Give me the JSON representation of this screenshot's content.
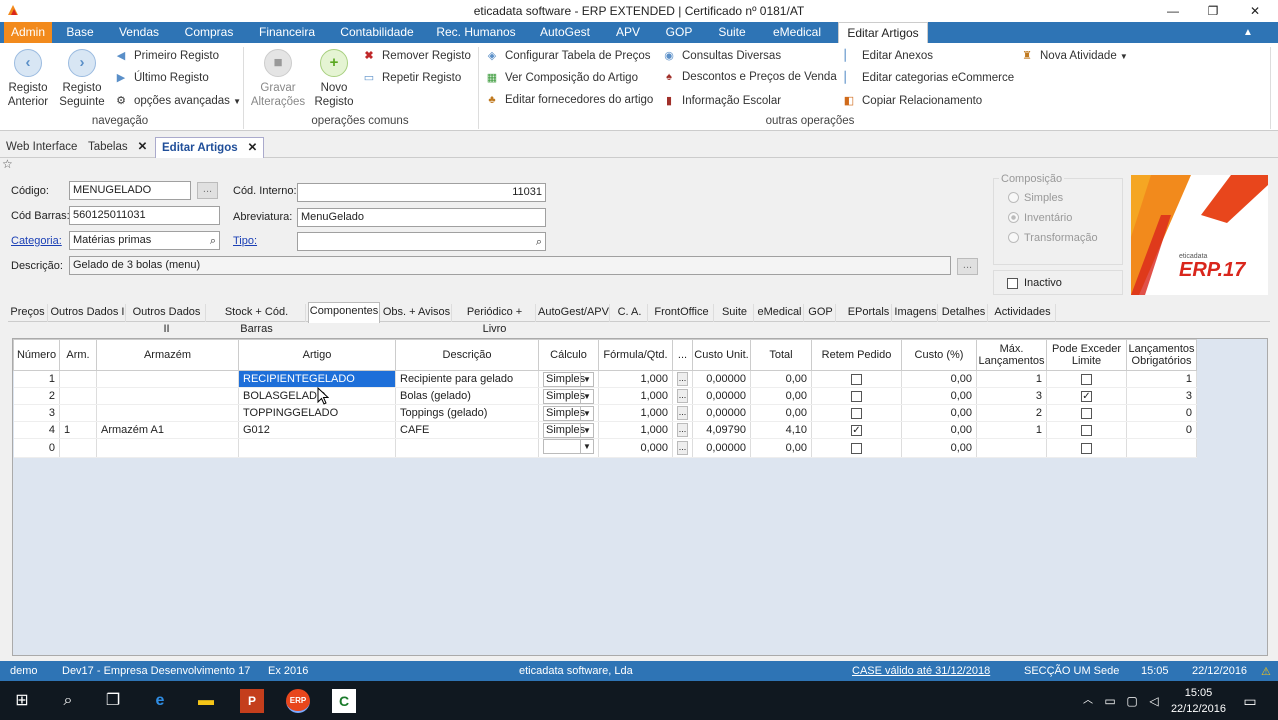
{
  "window": {
    "title": "eticadata software - ERP EXTENDED | Certificado nº 0181/AT",
    "minimize": "—",
    "restore": "❐",
    "close": "✕"
  },
  "menu": [
    "Admin",
    "Base",
    "Vendas",
    "Compras",
    "Financeira",
    "Contabilidade",
    "Rec. Humanos",
    "AutoGest",
    "APV",
    "GOP",
    "Suite",
    "eMedical",
    "Editar Artigos"
  ],
  "ribbon": {
    "nav": {
      "prev": "Registo Anterior",
      "next": "Registo Seguinte",
      "first": "Primeiro Registo",
      "last": "Último Registo",
      "advanced": "opções avançadas",
      "group": "navegação"
    },
    "common": {
      "save": "Gravar Alterações",
      "new": "Novo Registo",
      "remove": "Remover Registo",
      "repeat": "Repetir Registo",
      "group": "operações comuns"
    },
    "other": {
      "cfg_prices": "Configurar Tabela de Preços",
      "composition": "Ver Composição do Artigo",
      "suppliers": "Editar fornecedores do artigo",
      "queries": "Consultas Diversas",
      "discounts": "Descontos e Preços de Venda",
      "school": "Informação Escolar",
      "attachments": "Editar Anexos",
      "ecommerce": "Editar categorias eCommerce",
      "copy_rel": "Copiar Relacionamento",
      "new_activity": "Nova Atividade",
      "group": "outras operações"
    }
  },
  "doctabs": [
    "Web Interface",
    "Tabelas",
    "Editar Artigos"
  ],
  "form": {
    "codigo_label": "Código:",
    "codigo": "MENUGELADO",
    "barras_label": "Cód Barras:",
    "barras": "560125011031",
    "categoria_label": "Categoria:",
    "categoria": "Matérias primas",
    "descricao_label": "Descrição:",
    "descricao": "Gelado de 3 bolas (menu)",
    "interno_label": "Cód. Interno:",
    "interno": "11031",
    "abrev_label": "Abreviatura:",
    "abrev": "MenuGelado",
    "tipo_label": "Tipo:",
    "tipo": "",
    "composicao_label": "Composição",
    "opt_simples": "Simples",
    "opt_inventario": "Inventário",
    "opt_transformacao": "Transformação",
    "inactivo": "Inactivo"
  },
  "logo": {
    "brand": "eticadata",
    "product": "ERP.17"
  },
  "subtabs": [
    "Preços",
    "Outros Dados I",
    "Outros Dados II",
    "Stock + Cód. Barras",
    "Componentes",
    "Obs. + Avisos",
    "Periódico + Livro",
    "AutoGest/APV",
    "C. A.",
    "FrontOffice",
    "Suite",
    "eMedical",
    "GOP",
    "EPortals",
    "Imagens",
    "Detalhes",
    "Actividades"
  ],
  "grid": {
    "headers": [
      "Número",
      "Arm.",
      "Armazém",
      "Artigo",
      "Descrição",
      "Cálculo",
      "Fórmula/Qtd.",
      "...",
      "Custo Unit.",
      "Total",
      "Retem Pedido",
      "Custo (%)",
      "Máx. Lançamentos",
      "Pode Exceder Limite",
      "Lançamentos Obrigatórios"
    ],
    "rows": [
      {
        "num": "1",
        "arm": "",
        "armazem": "",
        "artigo": "RECIPIENTEGELADO",
        "desc": "Recipiente para gelado",
        "calc": "Simples",
        "qtd": "1,000",
        "custo": "0,00000",
        "total": "0,00",
        "retem": false,
        "pct": "0,00",
        "max": "1",
        "exceder": false,
        "obrig": "1"
      },
      {
        "num": "2",
        "arm": "",
        "armazem": "",
        "artigo": "BOLASGELADO",
        "desc": "Bolas (gelado)",
        "calc": "Simples",
        "qtd": "1,000",
        "custo": "0,00000",
        "total": "0,00",
        "retem": false,
        "pct": "0,00",
        "max": "3",
        "exceder": true,
        "obrig": "3"
      },
      {
        "num": "3",
        "arm": "",
        "armazem": "",
        "artigo": "TOPPINGGELADO",
        "desc": "Toppings (gelado)",
        "calc": "Simples",
        "qtd": "1,000",
        "custo": "0,00000",
        "total": "0,00",
        "retem": false,
        "pct": "0,00",
        "max": "2",
        "exceder": false,
        "obrig": "0"
      },
      {
        "num": "4",
        "arm": "1",
        "armazem": "Armazém A1",
        "artigo": "G012",
        "desc": "CAFE",
        "calc": "Simples",
        "qtd": "1,000",
        "custo": "4,09790",
        "total": "4,10",
        "retem": true,
        "pct": "0,00",
        "max": "1",
        "exceder": false,
        "obrig": "0"
      },
      {
        "num": "0",
        "arm": "",
        "armazem": "",
        "artigo": "",
        "desc": "",
        "calc": "",
        "qtd": "0,000",
        "custo": "0,00000",
        "total": "0,00",
        "retem": false,
        "pct": "0,00",
        "max": "",
        "exceder": false,
        "obrig": ""
      }
    ]
  },
  "status": {
    "user": "demo",
    "company": "Dev17 - Empresa Desenvolvimento 17",
    "year": "Ex 2016",
    "vendor": "eticadata software, Lda",
    "case": "CASE válido até 31/12/2018",
    "section": "SECÇÃO UM Sede",
    "time": "15:05",
    "date": "22/12/2016"
  },
  "taskbar": {
    "time": "15:05",
    "date": "22/12/2016"
  },
  "colors": {
    "accent": "#2e74b5",
    "admin": "#f28a1c",
    "selection": "#1e6fd9"
  }
}
